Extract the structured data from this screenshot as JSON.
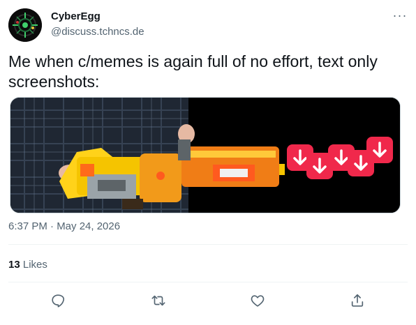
{
  "author": {
    "display_name": "CyberEgg",
    "handle": "@discuss.tchncs.de"
  },
  "post": {
    "text": "Me when c/memes is again full of no effort, text only screenshots:",
    "timestamp": "6:37 PM · May 24, 2026"
  },
  "stats": {
    "likes_count": "13",
    "likes_label": "Likes"
  },
  "menu": {
    "more_label": "···"
  },
  "icons": {
    "reply": "reply-icon",
    "retweet": "retweet-icon",
    "like": "heart-icon",
    "share": "share-icon",
    "downvote": "downvote-arrow-icon"
  },
  "colors": {
    "text_primary": "#0f1419",
    "text_secondary": "#536471",
    "downvote_red": "#f0284b"
  }
}
